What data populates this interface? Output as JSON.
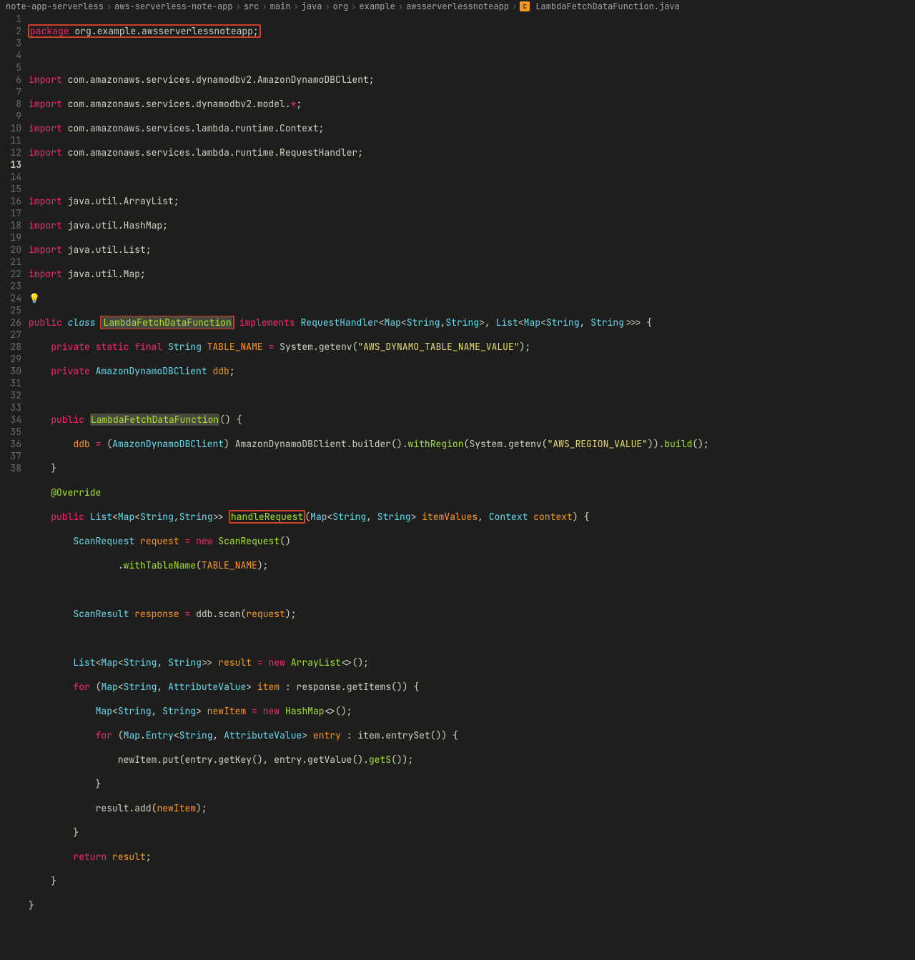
{
  "breadcrumbs": [
    "note-app-serverless",
    "aws-serverless-note-app",
    "src",
    "main",
    "java",
    "org",
    "example",
    "awsserverlessnoteapp"
  ],
  "fileName": "LambdaFetchDataFunction.java",
  "totalLines": 38,
  "currentLine": 13,
  "code": {
    "l1": {
      "pkg": "package",
      "pkgName": "org.example.awsserverlessnoteapp",
      ";": ";"
    },
    "l3": "com.amazonaws.services.dynamodbv2.AmazonDynamoDBClient",
    "l4": "com.amazonaws.services.dynamodbv2.model.",
    "l5": "com.amazonaws.services.lambda.runtime.Context",
    "l6": "com.amazonaws.services.lambda.runtime.RequestHandler",
    "l8": "java.util.ArrayList",
    "l9": "java.util.HashMap",
    "l10": "java.util.List",
    "l11": "java.util.Map",
    "kwImport": "import",
    "kwPublic": "public",
    "kwPrivate": "private",
    "kwClass": "class",
    "kwStatic": "static",
    "kwFinal": "final",
    "kwNew": "new",
    "kwFor": "for",
    "kwReturn": "return",
    "kwImplements": "implements",
    "className": "LambdaFetchDataFunction",
    "requestHandler": "RequestHandler",
    "tMap": "Map",
    "tString": "String",
    "tList": "List",
    "l14": {
      "fType": "String",
      "fName": "TABLE_NAME",
      "expr": "System.getenv",
      "str": "\"AWS_DYNAMO_TABLE_NAME_VALUE\""
    },
    "l15": {
      "fType": "AmazonDynamoDBClient",
      "fName": "ddb"
    },
    "l17": {
      "ctor": "LambdaFetchDataFunction"
    },
    "l18": {
      "lhs": "ddb",
      "cast": "AmazonDynamoDBClient",
      "expr": "AmazonDynamoDBClient.builder",
      "withRegion": "withRegion",
      "sysGetenv": "System.getenv",
      "str": "\"AWS_REGION_VALUE\"",
      "build": "build"
    },
    "l20": "@Override",
    "l21": {
      "ret": "List",
      "method": "handleRequest",
      "p1": "itemValues",
      "p2": "context",
      "ctx": "Context"
    },
    "l22": {
      "t": "ScanRequest",
      "v": "request",
      "ctor": "ScanRequest"
    },
    "l23": {
      "m": "withTableName",
      "arg": "TABLE_NAME"
    },
    "l25": {
      "t": "ScanResult",
      "v": "response",
      "call": "ddb.scan",
      "arg": "request"
    },
    "l27": {
      "v": "result",
      "ctor": "ArrayList"
    },
    "l28": {
      "t": "AttributeValue",
      "v": "item",
      "call": "response.getItems"
    },
    "l29": {
      "v": "newItem",
      "ctor": "HashMap"
    },
    "l30": {
      "entry": "Entry",
      "t": "AttributeValue",
      "v": "entry",
      "call": "item.entrySet"
    },
    "l31": {
      "call": "newItem.put",
      "k": "entry.getKey",
      "g": "entry.getValue",
      "s": "getS"
    },
    "l33": {
      "call": "result.add",
      "arg": "newItem"
    },
    "l35": {
      "v": "result"
    }
  }
}
